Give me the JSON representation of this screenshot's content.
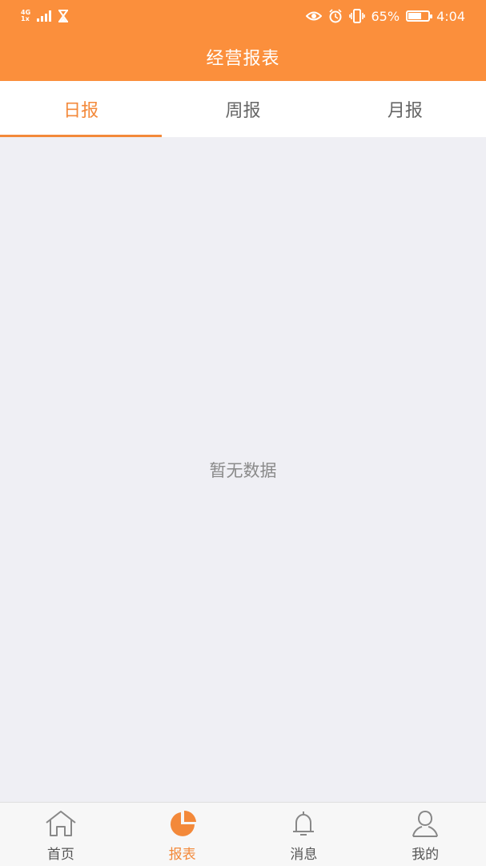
{
  "status_bar": {
    "network": [
      "4G",
      "1x"
    ],
    "battery_percent": "65%",
    "time": "4:04"
  },
  "header": {
    "title": "经营报表"
  },
  "tabs": [
    {
      "label": "日报",
      "active": true
    },
    {
      "label": "周报",
      "active": false
    },
    {
      "label": "月报",
      "active": false
    }
  ],
  "content": {
    "empty_text": "暂无数据"
  },
  "bottom_nav": [
    {
      "label": "首页",
      "icon": "home-icon",
      "active": false
    },
    {
      "label": "报表",
      "icon": "pie-chart-icon",
      "active": true
    },
    {
      "label": "消息",
      "icon": "bell-icon",
      "active": false
    },
    {
      "label": "我的",
      "icon": "user-icon",
      "active": false
    }
  ],
  "colors": {
    "accent": "#fb8f3c",
    "active_tab": "#f3893a",
    "background": "#efeff4"
  }
}
